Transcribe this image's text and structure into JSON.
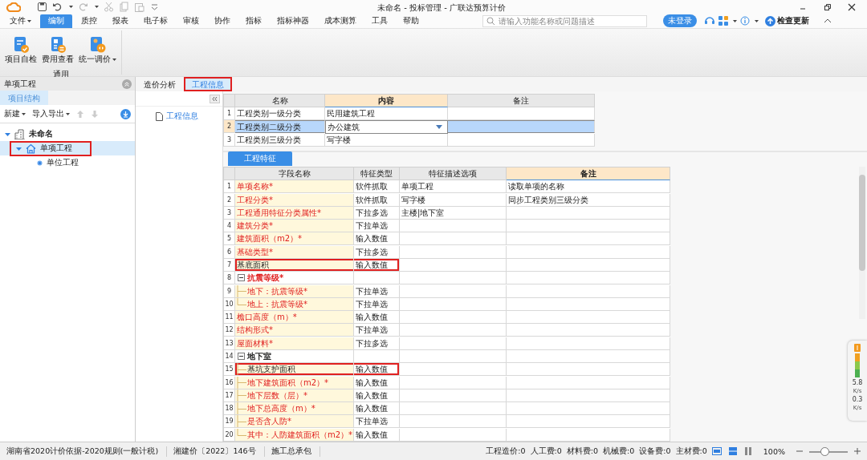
{
  "window": {
    "title": "未命名 - 投标管理 - 广联达预算计价"
  },
  "menu": [
    {
      "label": "文件",
      "dropdown": true,
      "selected": false
    },
    {
      "label": "编制",
      "selected": true
    },
    {
      "label": "质控",
      "selected": false
    },
    {
      "label": "报表",
      "selected": false
    },
    {
      "label": "电子标",
      "selected": false
    },
    {
      "label": "审核",
      "selected": false
    },
    {
      "label": "协作",
      "selected": false
    },
    {
      "label": "指标",
      "selected": false
    },
    {
      "label": "指标神器",
      "selected": false
    },
    {
      "label": "成本测算",
      "selected": false
    },
    {
      "label": "工具",
      "selected": false
    },
    {
      "label": "帮助",
      "selected": false
    }
  ],
  "search": {
    "placeholder": "请输入功能名称或问题描述"
  },
  "login_button": "未登录",
  "update_button": "检查更新",
  "ribbon": {
    "group": "通用",
    "buttons": [
      {
        "label": "项目自检",
        "dropdown": false
      },
      {
        "label": "费用查看",
        "dropdown": false
      },
      {
        "label": "统一调价",
        "dropdown": true
      }
    ]
  },
  "left_panel": {
    "title": "单项工程",
    "tabs": [
      {
        "label": "项目结构",
        "selected": true
      }
    ],
    "toolbar": [
      {
        "label": "新建",
        "kind": "menu"
      },
      {
        "label": "导入导出",
        "kind": "menu"
      },
      {
        "kind": "up",
        "disabled": true
      },
      {
        "kind": "down",
        "disabled": true
      }
    ],
    "tree": [
      {
        "label": "未命名",
        "kind": "building",
        "expanded": true,
        "selected": false,
        "annotated": false,
        "children": [
          {
            "label": "单项工程",
            "kind": "house",
            "expanded": true,
            "selected": true,
            "annotated": true,
            "children": [
              {
                "label": "单位工程",
                "kind": "unit",
                "selected": false,
                "annotated": false
              }
            ]
          }
        ]
      }
    ]
  },
  "content_tabs": [
    {
      "label": "造价分析",
      "selected": false,
      "annotated": false
    },
    {
      "label": "工程信息",
      "selected": true,
      "annotated": true
    }
  ],
  "nav": {
    "items": [
      {
        "label": "工程信息",
        "selected": true
      }
    ]
  },
  "info_table": {
    "columns": [
      {
        "label": "名称",
        "current": false
      },
      {
        "label": "内容",
        "current": true
      },
      {
        "label": "备注",
        "current": false
      }
    ],
    "rows": [
      {
        "no": "1",
        "name": "工程类别一级分类",
        "content": "民用建筑工程",
        "note": "",
        "selected": false,
        "dropdown": false
      },
      {
        "no": "2",
        "name": "工程类别二级分类",
        "content": "办公建筑",
        "note": "",
        "selected": true,
        "dropdown": true
      },
      {
        "no": "3",
        "name": "工程类别三级分类",
        "content": "写字楼",
        "note": "",
        "selected": false,
        "dropdown": false
      }
    ]
  },
  "features": {
    "tab": "工程特征",
    "columns": [
      {
        "label": "字段名称",
        "current": false
      },
      {
        "label": "特征类型",
        "current": false
      },
      {
        "label": "特征描述选项",
        "current": false
      },
      {
        "label": "备注",
        "current": true
      }
    ],
    "rows": [
      {
        "no": "1",
        "name": "单项名称*",
        "type": "软件抓取",
        "option": "单项工程",
        "note": "读取单项的名称",
        "required": true,
        "annotated": false
      },
      {
        "no": "2",
        "name": "工程分类*",
        "type": "软件抓取",
        "option": "写字楼",
        "note": "同步工程类别三级分类",
        "required": true,
        "annotated": false
      },
      {
        "no": "3",
        "name": "工程通用特征分类属性*",
        "type": "下拉多选",
        "option": "主楼|地下室",
        "required": true,
        "annotated": false
      },
      {
        "no": "4",
        "name": "建筑分类*",
        "type": "下拉单选",
        "required": true,
        "annotated": false
      },
      {
        "no": "5",
        "name": "建筑面积（m2）*",
        "type": "输入数值",
        "required": true,
        "annotated": false
      },
      {
        "no": "6",
        "name": "基础类型*",
        "type": "下拉多选",
        "required": true,
        "annotated": false
      },
      {
        "no": "7",
        "name": "基底面积",
        "type": "输入数值",
        "required": false,
        "annotated": true
      },
      {
        "no": "8",
        "name": "抗震等级*",
        "kind": "group",
        "expanded": true,
        "required": true,
        "annotated": false,
        "children": [
          {
            "no": "9",
            "name": "地下：抗震等级*",
            "type": "下拉单选",
            "required": true,
            "annotated": false
          },
          {
            "no": "10",
            "name": "地上：抗震等级*",
            "type": "下拉单选",
            "required": true,
            "annotated": false
          }
        ]
      },
      {
        "no": "11",
        "name": "檐口高度（m）*",
        "type": "输入数值",
        "required": true,
        "annotated": false
      },
      {
        "no": "12",
        "name": "结构形式*",
        "type": "下拉单选",
        "required": true,
        "annotated": false
      },
      {
        "no": "13",
        "name": "屋面材料*",
        "type": "下拉多选",
        "required": true,
        "annotated": false
      },
      {
        "no": "14",
        "name": "地下室",
        "kind": "group",
        "expanded": true,
        "required": false,
        "annotated": false,
        "children": [
          {
            "no": "15",
            "name": "基坑支护面积",
            "type": "输入数值",
            "required": false,
            "annotated": true
          },
          {
            "no": "16",
            "name": "地下建筑面积（m2）*",
            "type": "输入数值",
            "required": true,
            "annotated": false
          },
          {
            "no": "17",
            "name": "地下层数（层）*",
            "type": "输入数值",
            "required": true,
            "annotated": false
          },
          {
            "no": "18",
            "name": "地下总高度（m）*",
            "type": "输入数值",
            "required": true,
            "annotated": false
          },
          {
            "no": "19",
            "name": "是否含人防*",
            "type": "下拉单选",
            "required": true,
            "annotated": false
          },
          {
            "no": "20",
            "name": "其中：人防建筑面积（m2）*",
            "type": "输入数值",
            "required": true,
            "annotated": false
          }
        ]
      }
    ]
  },
  "speed_widget": {
    "readings": [
      {
        "value": "5.8",
        "unit": "K/s"
      },
      {
        "value": "0.3",
        "unit": "K/s"
      }
    ]
  },
  "status_bar": {
    "left": [
      "湖南省2020计价依据-2020规则(一般计税)",
      "湘建价〔2022〕146号",
      "施工总承包"
    ],
    "costs": [
      "工程造价:0",
      "人工费:0",
      "材料费:0",
      "机械费:0",
      "设备费:0",
      "主材费:0"
    ],
    "zoom": "100%",
    "zoom_slider": {
      "level": 0.4
    }
  }
}
